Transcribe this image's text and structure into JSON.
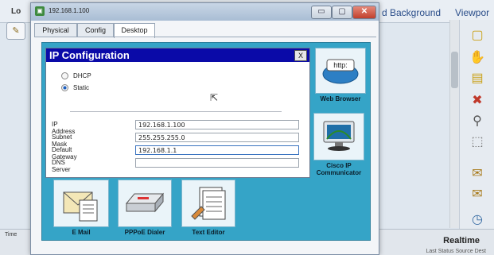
{
  "background": {
    "app_label_partial": "Lo",
    "tabs": [
      "d Background",
      "Viewpor"
    ],
    "time_label": "Time",
    "realtime_label": "Realtime",
    "status_text": "Last Status   Source  Dest"
  },
  "window": {
    "title": "192.168.1.100",
    "tabs": {
      "physical": "Physical",
      "config": "Config",
      "desktop": "Desktop"
    },
    "controls": {
      "minimize": "▭",
      "maximize": "▢",
      "close": "✕"
    }
  },
  "ip_config": {
    "title": "IP Configuration",
    "close": "X",
    "dhcp_label": "DHCP",
    "static_label": "Static",
    "selected_mode": "Static",
    "ip_address_label": "IP Address",
    "ip_address": "192.168.1.100",
    "subnet_mask_label": "Subnet Mask",
    "subnet_mask": "255.255.255.0",
    "default_gateway_label": "Default Gateway",
    "default_gateway": "192.168.1.1",
    "dns_server_label": "DNS Server",
    "dns_server": ""
  },
  "apps": {
    "web_browser": "Web Browser",
    "web_browser_icon_text": "http:",
    "cisco_ip_communicator_line1": "Cisco IP",
    "cisco_ip_communicator_line2": "Communicator",
    "email": "E Mail",
    "pppoe_dialer": "PPPoE Dialer",
    "text_editor": "Text Editor"
  },
  "colors": {
    "desktop_bg": "#35a4c7",
    "dialog_titlebar": "#0a0aa8"
  }
}
